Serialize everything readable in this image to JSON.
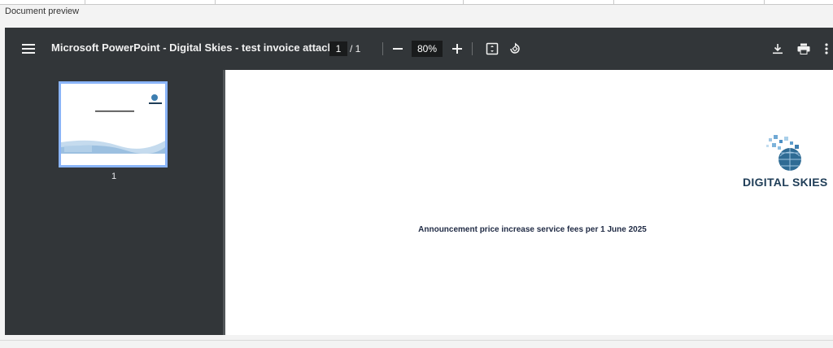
{
  "section": {
    "label": "Document preview"
  },
  "viewer": {
    "title": "Microsoft PowerPoint - Digital Skies - test invoice attach...",
    "current_page": "1",
    "page_total": "/ 1",
    "zoom": "80%",
    "menu_icon": "hamburger-menu-icon",
    "zoom_out_icon": "minus-icon",
    "zoom_in_icon": "plus-icon",
    "fit_icon": "fit-to-page-icon",
    "rotate_icon": "rotate-icon",
    "download_icon": "download-icon",
    "print_icon": "print-icon",
    "more_icon": "more-vertical-icon"
  },
  "sidebar": {
    "thumbnails": [
      {
        "page_number": "1"
      }
    ]
  },
  "document": {
    "logo_text": "DIGITAL SKIES",
    "announcement": "Announcement price increase service fees per 1 June 2025"
  },
  "colors": {
    "toolbar": "#323639",
    "viewer_bg": "#525659",
    "thumb_highlight": "#8ab4f8",
    "logo_blue": "#1f3d57"
  }
}
